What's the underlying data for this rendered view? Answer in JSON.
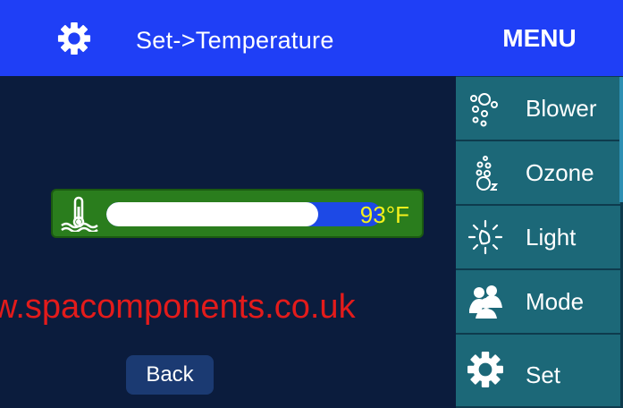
{
  "header": {
    "title": "Set->Temperature"
  },
  "temperature": {
    "value": "93°F",
    "level_percent": 77
  },
  "watermark": "w.spacomponents.co.uk",
  "back_label": "Back",
  "menu": {
    "title": "MENU",
    "items": [
      {
        "label": "Blower",
        "icon": "bubbles-icon"
      },
      {
        "label": "Ozone",
        "icon": "ozone-icon"
      },
      {
        "label": "Light",
        "icon": "light-icon"
      },
      {
        "label": "Mode",
        "icon": "users-icon"
      },
      {
        "label": "Set",
        "icon": "gear-icon"
      }
    ]
  },
  "colors": {
    "header": "#1f3ff6",
    "background": "#0b1c3d",
    "temp_bar": "#2a7d1d",
    "temp_text": "#f4f11c",
    "menu_item": "#1c6878",
    "watermark": "#e31b1b"
  }
}
